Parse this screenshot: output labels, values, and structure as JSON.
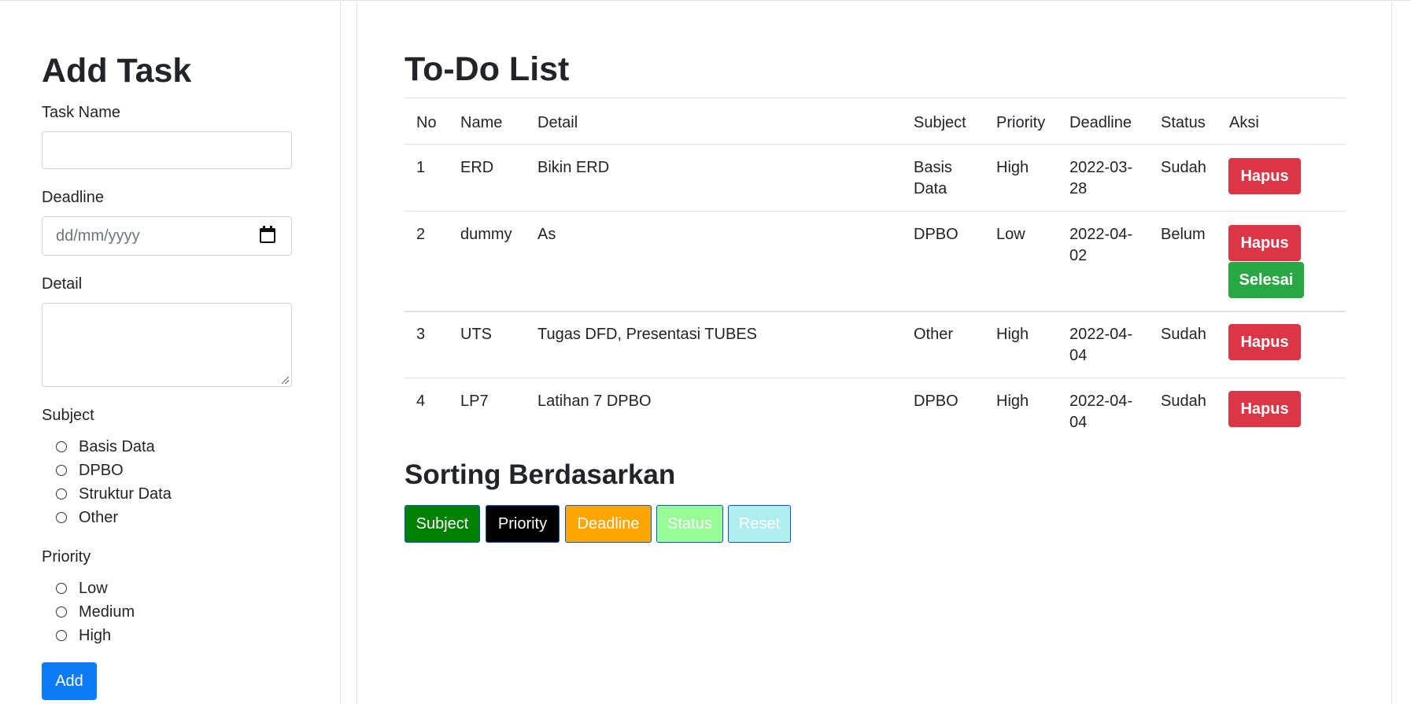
{
  "form": {
    "title": "Add Task",
    "task_name_label": "Task Name",
    "deadline_label": "Deadline",
    "deadline_placeholder": "dd/mm/yyyy",
    "detail_label": "Detail",
    "subject_label": "Subject",
    "subjects": [
      "Basis Data",
      "DPBO",
      "Struktur Data",
      "Other"
    ],
    "priority_label": "Priority",
    "priorities": [
      "Low",
      "Medium",
      "High"
    ],
    "add_button": "Add"
  },
  "list": {
    "title": "To-Do List",
    "headers": {
      "no": "No",
      "name": "Name",
      "detail": "Detail",
      "subject": "Subject",
      "priority": "Priority",
      "deadline": "Deadline",
      "status": "Status",
      "aksi": "Aksi"
    },
    "rows": [
      {
        "no": "1",
        "name": "ERD",
        "detail": "Bikin ERD",
        "subject": "Basis\nData",
        "priority": "High",
        "deadline": "2022-03-\n28",
        "status": "Sudah",
        "delete": "Hapus"
      },
      {
        "no": "2",
        "name": "dummy",
        "detail": "As",
        "subject": "DPBO",
        "priority": "Low",
        "deadline": "2022-04-\n02",
        "status": "Belum",
        "delete": "Hapus",
        "finish": "Selesai"
      },
      {
        "no": "3",
        "name": "UTS",
        "detail": "Tugas DFD, Presentasi TUBES",
        "subject": "Other",
        "priority": "High",
        "deadline": "2022-04-\n04",
        "status": "Sudah",
        "delete": "Hapus"
      },
      {
        "no": "4",
        "name": "LP7",
        "detail": "Latihan 7 DPBO",
        "subject": "DPBO",
        "priority": "High",
        "deadline": "2022-04-\n04",
        "status": "Sudah",
        "delete": "Hapus"
      }
    ]
  },
  "sorting": {
    "title": "Sorting Berdasarkan",
    "buttons": [
      {
        "label": "Subject",
        "bg": "#008000",
        "color": "#ffffff"
      },
      {
        "label": "Priority",
        "bg": "#000000",
        "color": "#ffffff"
      },
      {
        "label": "Deadline",
        "bg": "#ffa500",
        "color": "#ffffff"
      },
      {
        "label": "Status",
        "bg": "#98fb98",
        "color": "#ffffff"
      },
      {
        "label": "Reset",
        "bg": "#afeeee",
        "color": "#ffffff"
      }
    ]
  },
  "colors": {
    "primary": "#0d7bf5",
    "danger": "#dc3545",
    "success": "#28a745"
  },
  "icons": {
    "date": "calendar-icon",
    "textarea": "resize-grip-icon"
  }
}
